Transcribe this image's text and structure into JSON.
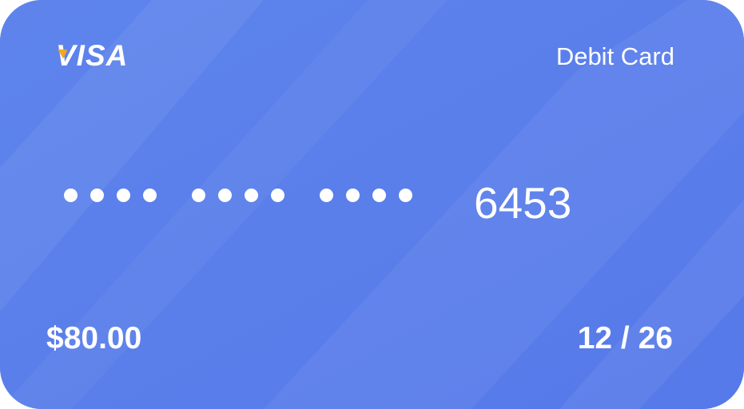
{
  "card": {
    "brand": "VISA",
    "type_label": "Debit Card",
    "masked_groups": 3,
    "last4": "6453",
    "balance": "$80.00",
    "expiry": "12 / 26"
  },
  "colors": {
    "card_background": "#5a7fea",
    "text": "#ffffff",
    "brand_accent": "#f5a623"
  },
  "icons": {
    "brand_logo": "visa-logo-icon"
  }
}
